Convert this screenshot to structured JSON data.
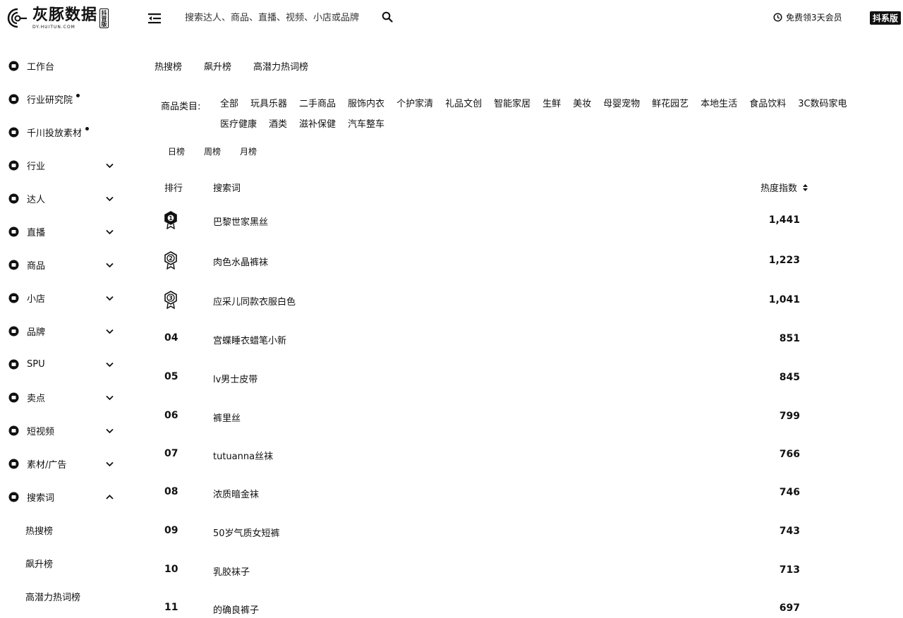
{
  "header": {
    "logo_title": "灰豚数据",
    "logo_sub": "DY.HUITUN.COM",
    "logo_badge": "抖音版",
    "search_placeholder": "搜索达人、商品、直播、视频、小店或品牌",
    "trial_label": "免费领3天会员",
    "version_label": "抖系版"
  },
  "sidebar": {
    "items": [
      {
        "label": "工作台",
        "icon": "home-icon",
        "dot": false,
        "chevron": ""
      },
      {
        "label": "行业研究院",
        "icon": "research-icon",
        "dot": true,
        "chevron": ""
      },
      {
        "label": "千川投放素材",
        "icon": "ad-icon",
        "dot": true,
        "chevron": ""
      },
      {
        "label": "行业",
        "icon": "industry-icon",
        "dot": false,
        "chevron": "down"
      },
      {
        "label": "达人",
        "icon": "influencer-icon",
        "dot": false,
        "chevron": "down"
      },
      {
        "label": "直播",
        "icon": "live-icon",
        "dot": false,
        "chevron": "down"
      },
      {
        "label": "商品",
        "icon": "goods-icon",
        "dot": false,
        "chevron": "down"
      },
      {
        "label": "小店",
        "icon": "shop-icon",
        "dot": false,
        "chevron": "down"
      },
      {
        "label": "品牌",
        "icon": "brand-icon",
        "dot": false,
        "chevron": "down"
      },
      {
        "label": "SPU",
        "icon": "spu-icon",
        "dot": false,
        "chevron": "down"
      },
      {
        "label": "卖点",
        "icon": "selling-point-icon",
        "dot": false,
        "chevron": "down"
      },
      {
        "label": "短视频",
        "icon": "video-icon",
        "dot": false,
        "chevron": "down"
      },
      {
        "label": "素材/广告",
        "icon": "material-icon",
        "dot": false,
        "chevron": "down"
      },
      {
        "label": "搜索词",
        "icon": "search-term-icon",
        "dot": false,
        "chevron": "up"
      }
    ],
    "sub_items": [
      "热搜榜",
      "飙升榜",
      "高潜力热词榜"
    ]
  },
  "tabs": [
    "热搜榜",
    "飙升榜",
    "高潜力热词榜"
  ],
  "category_label": "商品类目:",
  "categories": [
    "全部",
    "玩具乐器",
    "二手商品",
    "服饰内衣",
    "个护家清",
    "礼品文创",
    "智能家居",
    "生鲜",
    "美妆",
    "母婴宠物",
    "鲜花园艺",
    "本地生活",
    "食品饮料",
    "3C数码家电",
    "医疗健康",
    "酒类",
    "滋补保健",
    "汽车整车"
  ],
  "periods": [
    "日榜",
    "周榜",
    "月榜"
  ],
  "table": {
    "headers": {
      "rank": "排行",
      "term": "搜索词",
      "heat": "热度指数"
    },
    "rows": [
      {
        "rank": "01",
        "term": "巴黎世家黑丝",
        "heat": "1,441"
      },
      {
        "rank": "02",
        "term": "肉色水晶裤袜",
        "heat": "1,223"
      },
      {
        "rank": "03",
        "term": "应采儿同款衣服白色",
        "heat": "1,041"
      },
      {
        "rank": "04",
        "term": "宫蝶睡衣蜡笔小新",
        "heat": "851"
      },
      {
        "rank": "05",
        "term": "lv男士皮带",
        "heat": "845"
      },
      {
        "rank": "06",
        "term": "裤里丝",
        "heat": "799"
      },
      {
        "rank": "07",
        "term": "tutuanna丝袜",
        "heat": "766"
      },
      {
        "rank": "08",
        "term": "浓质暗金袜",
        "heat": "746"
      },
      {
        "rank": "09",
        "term": "50岁气质女短裤",
        "heat": "743"
      },
      {
        "rank": "10",
        "term": "乳胶袜子",
        "heat": "713"
      },
      {
        "rank": "11",
        "term": "的确良裤子",
        "heat": "697"
      }
    ]
  }
}
